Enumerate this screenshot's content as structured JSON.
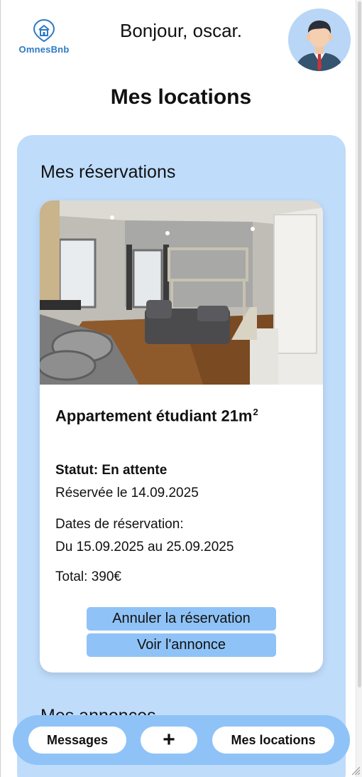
{
  "header": {
    "logo_text": "OmnesBnb",
    "greeting": "Bonjour, oscar."
  },
  "page": {
    "title": "Mes locations"
  },
  "reservations": {
    "section_title": "Mes réservations",
    "items": [
      {
        "title": "Appartement étudiant 21m",
        "title_sup": "2",
        "status": "Statut: En attente",
        "reserved_on": "Réservée le 14.09.2025",
        "dates_label": "Dates de réservation:",
        "dates_range": "Du 15.09.2025 au 25.09.2025",
        "total": "Total: 390€",
        "cancel_label": "Annuler la réservation",
        "view_label": "Voir l'annonce"
      }
    ]
  },
  "listings": {
    "section_title": "Mes annonces"
  },
  "bottom_nav": {
    "messages_label": "Messages",
    "add_label": "+",
    "locations_label": "Mes locations"
  },
  "colors": {
    "panel_bg": "#bfdcfb",
    "button_blue": "#8fc3f7",
    "logo_blue": "#2e79c4"
  }
}
